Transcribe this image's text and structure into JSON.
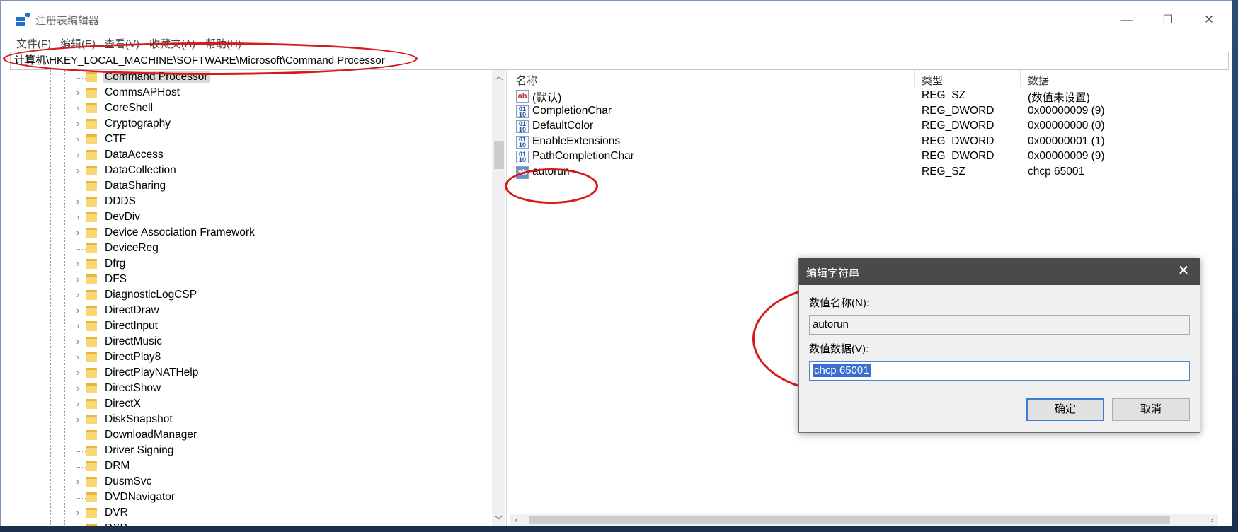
{
  "window": {
    "title": "注册表编辑器",
    "controls": {
      "minimize": "—",
      "maximize": "☐",
      "close": "✕"
    }
  },
  "menu": [
    "文件(F)",
    "编辑(E)",
    "查看(V)",
    "收藏夹(A)",
    "帮助(H)"
  ],
  "address": "计算机\\HKEY_LOCAL_MACHINE\\SOFTWARE\\Microsoft\\Command Processor",
  "tree": {
    "items": [
      {
        "label": "Command Processor",
        "expandable": false,
        "selected": true
      },
      {
        "label": "CommsAPHost",
        "expandable": true
      },
      {
        "label": "CoreShell",
        "expandable": true
      },
      {
        "label": "Cryptography",
        "expandable": true
      },
      {
        "label": "CTF",
        "expandable": true
      },
      {
        "label": "DataAccess",
        "expandable": true
      },
      {
        "label": "DataCollection",
        "expandable": true
      },
      {
        "label": "DataSharing",
        "expandable": false
      },
      {
        "label": "DDDS",
        "expandable": true
      },
      {
        "label": "DevDiv",
        "expandable": true
      },
      {
        "label": "Device Association Framework",
        "expandable": true
      },
      {
        "label": "DeviceReg",
        "expandable": false
      },
      {
        "label": "Dfrg",
        "expandable": true
      },
      {
        "label": "DFS",
        "expandable": true
      },
      {
        "label": "DiagnosticLogCSP",
        "expandable": true
      },
      {
        "label": "DirectDraw",
        "expandable": true
      },
      {
        "label": "DirectInput",
        "expandable": true
      },
      {
        "label": "DirectMusic",
        "expandable": true
      },
      {
        "label": "DirectPlay8",
        "expandable": true
      },
      {
        "label": "DirectPlayNATHelp",
        "expandable": true
      },
      {
        "label": "DirectShow",
        "expandable": true
      },
      {
        "label": "DirectX",
        "expandable": true
      },
      {
        "label": "DiskSnapshot",
        "expandable": true
      },
      {
        "label": "DownloadManager",
        "expandable": false
      },
      {
        "label": "Driver Signing",
        "expandable": false
      },
      {
        "label": "DRM",
        "expandable": false
      },
      {
        "label": "DusmSvc",
        "expandable": true
      },
      {
        "label": "DVDNavigator",
        "expandable": false
      },
      {
        "label": "DVR",
        "expandable": true
      },
      {
        "label": "DXP",
        "expandable": true
      }
    ]
  },
  "list": {
    "columns": {
      "name": "名称",
      "type": "类型",
      "data": "数据"
    },
    "rows": [
      {
        "name": "(默认)",
        "type": "REG_SZ",
        "data": "(数值未设置)",
        "icon": "string-value-icon"
      },
      {
        "name": "CompletionChar",
        "type": "REG_DWORD",
        "data": "0x00000009 (9)",
        "icon": "binary-value-icon"
      },
      {
        "name": "DefaultColor",
        "type": "REG_DWORD",
        "data": "0x00000000 (0)",
        "icon": "binary-value-icon"
      },
      {
        "name": "EnableExtensions",
        "type": "REG_DWORD",
        "data": "0x00000001 (1)",
        "icon": "binary-value-icon"
      },
      {
        "name": "PathCompletionChar",
        "type": "REG_DWORD",
        "data": "0x00000009 (9)",
        "icon": "binary-value-icon"
      },
      {
        "name": "autorun",
        "type": "REG_SZ",
        "data": "chcp 65001",
        "icon": "string-value-icon"
      }
    ]
  },
  "dialog": {
    "title": "编辑字符串",
    "name_label": "数值名称(N):",
    "name_value": "autorun",
    "data_label": "数值数据(V):",
    "data_value": "chcp 65001",
    "ok": "确定",
    "cancel": "取消"
  },
  "colors": {
    "annotation": "#d61a1a",
    "dialog_title_bg": "#4a4a4a",
    "selection": "#3a6fcf"
  }
}
